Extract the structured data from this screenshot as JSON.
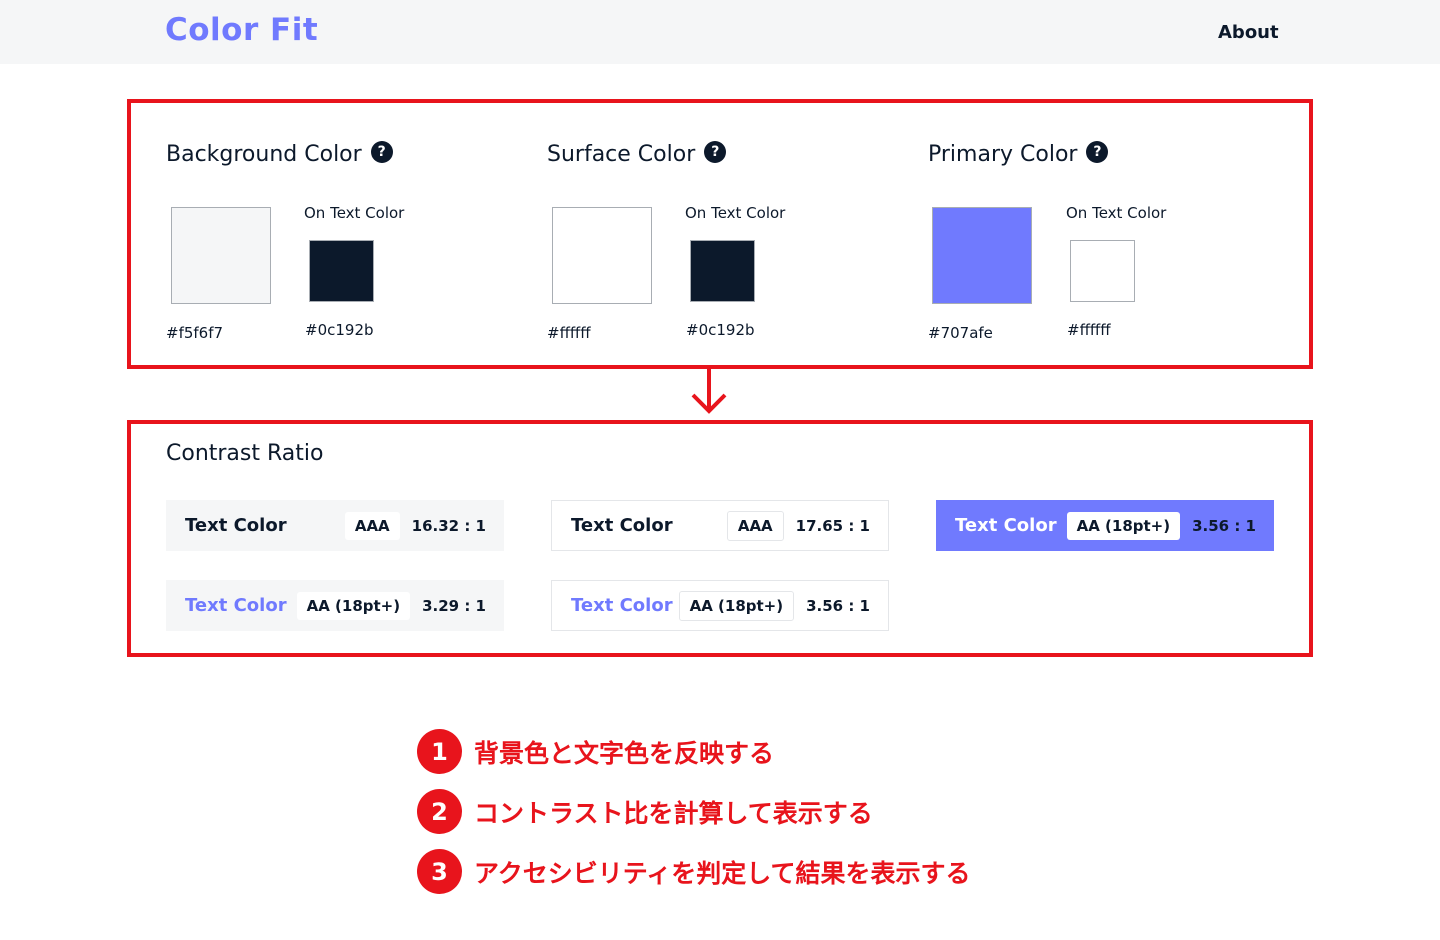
{
  "header": {
    "brand": "Color Fit",
    "about": "About"
  },
  "colors": {
    "columns": [
      {
        "title": "Background Color",
        "on_text_label": "On Text Color",
        "color": "#f5f6f7",
        "color_hex": "#f5f6f7",
        "on_text": "#0c192b",
        "on_text_hex": "#0c192b"
      },
      {
        "title": "Surface Color",
        "on_text_label": "On Text Color",
        "color": "#ffffff",
        "color_hex": "#ffffff",
        "on_text": "#0c192b",
        "on_text_hex": "#0c192b"
      },
      {
        "title": "Primary Color",
        "on_text_label": "On Text Color",
        "color": "#707afe",
        "color_hex": "#707afe",
        "on_text": "#ffffff",
        "on_text_hex": "#ffffff"
      }
    ],
    "help_glyph": "?"
  },
  "contrast": {
    "title": "Contrast Ratio",
    "cards": [
      {
        "text": "Text Color",
        "badge": "AAA",
        "ratio": "16.32 : 1"
      },
      {
        "text": "Text Color",
        "badge": "AAA",
        "ratio": "17.65 : 1"
      },
      {
        "text": "Text Color",
        "badge": "AA (18pt+)",
        "ratio": "3.56 : 1"
      },
      {
        "text": "Text Color",
        "badge": "AA (18pt+)",
        "ratio": "3.29 : 1"
      },
      {
        "text": "Text Color",
        "badge": "AA (18pt+)",
        "ratio": "3.56 : 1"
      }
    ]
  },
  "legend": [
    {
      "num": "1",
      "text": "背景色と文字色を反映する"
    },
    {
      "num": "2",
      "text": "コントラスト比を計算して表示する"
    },
    {
      "num": "3",
      "text": "アクセシビリティを判定して結果を表示する"
    }
  ],
  "theme": {
    "text": "#0c192b",
    "primary": "#707afe",
    "surface": "#ffffff",
    "background": "#f5f6f7",
    "annotation_red": "#e8141c"
  }
}
